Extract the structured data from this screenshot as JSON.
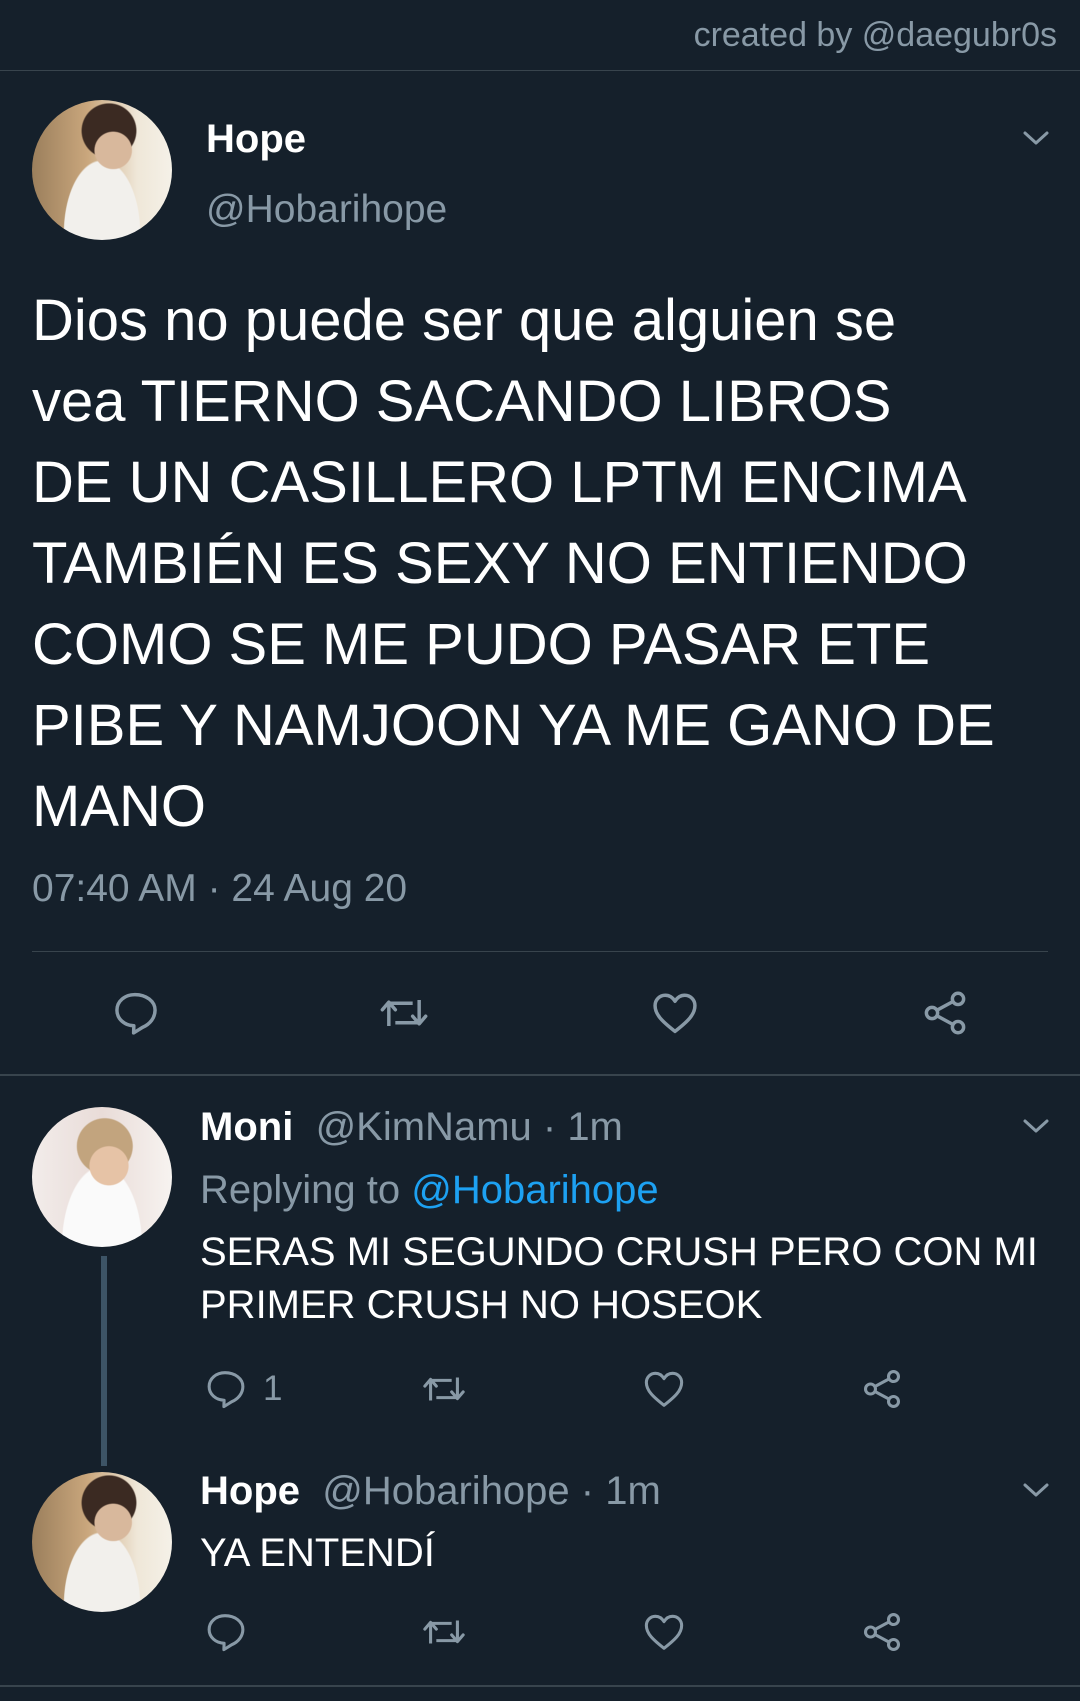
{
  "credit": "created by @daegubr0s",
  "main_tweet": {
    "name": "Hope",
    "handle": "@Hobarihope",
    "text": "Dios no puede ser que alguien se\nvea TIERNO SACANDO LIBROS\nDE UN CASILLERO LPTM ENCIMA\nTAMBIÉN ES SEXY NO ENTIENDO\nCOMO SE ME PUDO PASAR ETE\nPIBE Y NAMJOON YA ME GANO DE\nMANO",
    "timestamp": "07:40 AM · 24 Aug 20"
  },
  "replies": [
    {
      "name": "Moni",
      "handle": "@KimNamu",
      "meta": " · 1m",
      "replying_prefix": "Replying to ",
      "replying_to": "@Hobarihope",
      "text": "SERAS MI SEGUNDO CRUSH PERO CON MI\nPRIMER CRUSH NO HOSEOK",
      "reply_count": "1"
    },
    {
      "name": "Hope",
      "handle": "@Hobarihope",
      "meta": " · 1m",
      "text": "YA ENTENDÍ"
    }
  ],
  "icons": {
    "reply": "speech-bubble-icon",
    "retweet": "retweet-arrows-icon",
    "like": "heart-icon",
    "share": "share-nodes-icon",
    "menu": "chevron-down-icon"
  },
  "colors": {
    "background": "#15202b",
    "divider": "#38444d",
    "muted_text": "#8899a6",
    "link": "#1da1f2",
    "thread_line": "#3d5466"
  }
}
